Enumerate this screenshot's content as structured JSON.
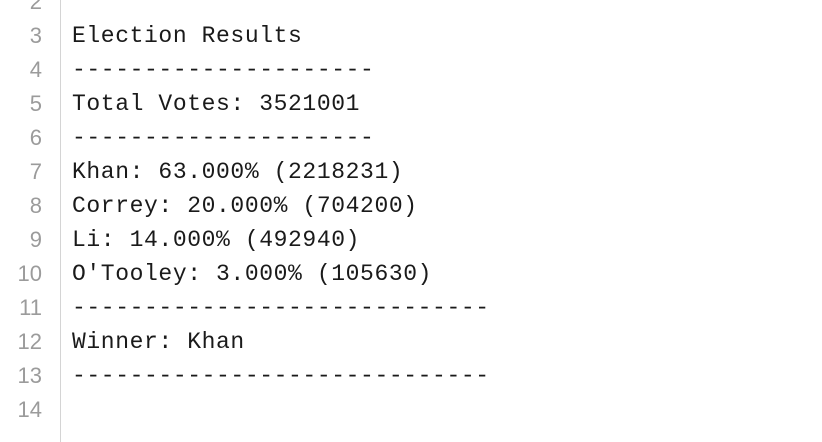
{
  "editor": {
    "line_numbers": [
      "2",
      "3",
      "4",
      "5",
      "6",
      "7",
      "8",
      "9",
      "10",
      "11",
      "12",
      "13",
      "14"
    ],
    "lines": [
      "",
      "Election Results",
      "---------------------",
      "Total Votes: 3521001",
      "---------------------",
      "Khan: 63.000% (2218231)",
      "Correy: 20.000% (704200)",
      "Li: 14.000% (492940)",
      "O'Tooley: 3.000% (105630)",
      "-----------------------------",
      "Winner: Khan",
      "-----------------------------",
      ""
    ]
  }
}
